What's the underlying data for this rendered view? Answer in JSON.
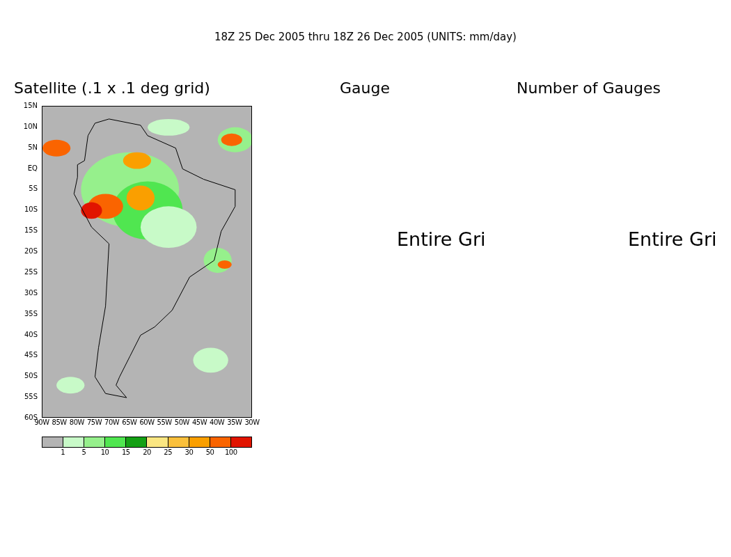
{
  "header": "18Z 25 Dec 2005 thru 18Z 26 Dec 2005 (UNITS: mm/day)",
  "panels": [
    {
      "kind": "map",
      "title": "Satellite (.1 x .1 deg grid)",
      "y_labels": [
        "15N",
        "10N",
        "5N",
        "EQ",
        "5S",
        "10S",
        "15S",
        "20S",
        "25S",
        "30S",
        "35S",
        "40S",
        "45S",
        "50S",
        "55S",
        "60S"
      ],
      "x_labels": [
        "90W",
        "85W",
        "80W",
        "75W",
        "70W",
        "65W",
        "60W",
        "55W",
        "50W",
        "45W",
        "40W",
        "35W",
        "30W"
      ],
      "legend": {
        "cells": [
          {
            "color": "#b4b4b4"
          },
          {
            "color": "#c8fac8"
          },
          {
            "color": "#96f08c"
          },
          {
            "color": "#50e650"
          },
          {
            "color": "#14a014"
          },
          {
            "color": "#fae682"
          },
          {
            "color": "#fac03c"
          },
          {
            "color": "#fa9f00"
          },
          {
            "color": "#fa6400"
          },
          {
            "color": "#e11400"
          }
        ],
        "labels": [
          "1",
          "5",
          "10",
          "15",
          "20",
          "25",
          "30",
          "50",
          "100"
        ]
      }
    },
    {
      "kind": "empty",
      "title": "Gauge",
      "message": "Entire Gri"
    },
    {
      "kind": "empty",
      "title": "Number of Gauges",
      "message": "Entire Gri"
    }
  ]
}
